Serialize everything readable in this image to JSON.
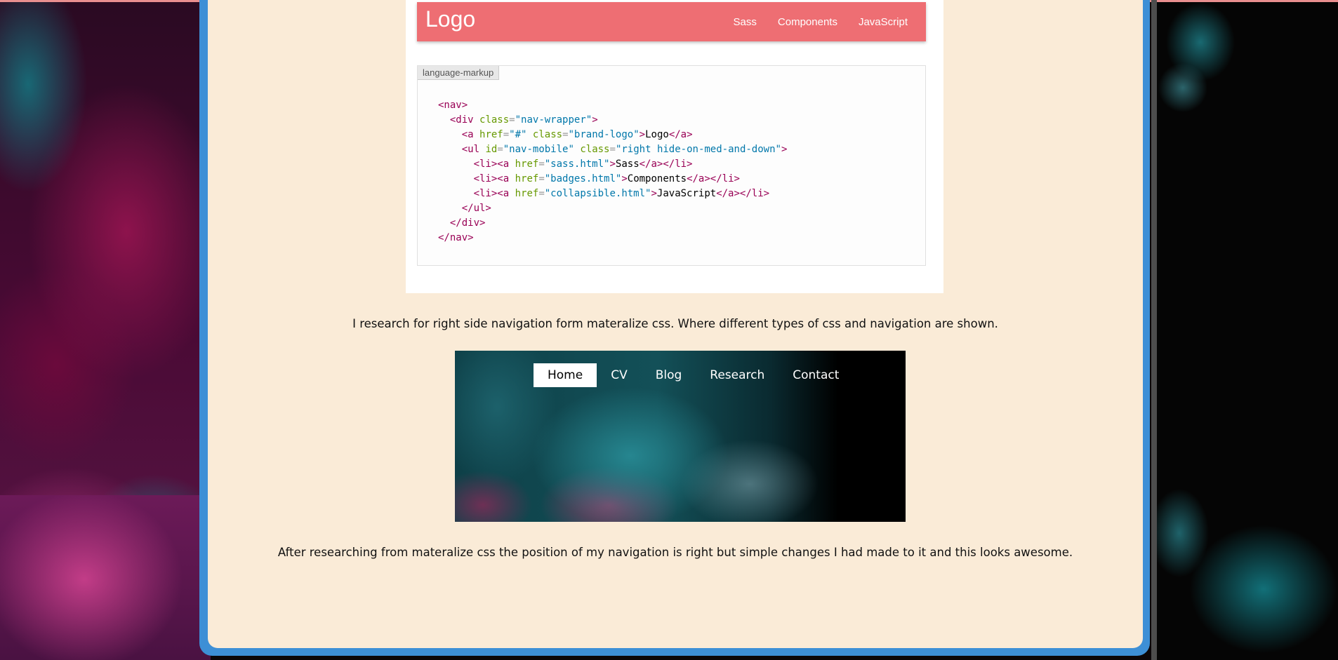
{
  "materialize_nav": {
    "logo": "Logo",
    "links": [
      "Sass",
      "Components",
      "JavaScript"
    ]
  },
  "code_block": {
    "language_label": "language-markup"
  },
  "text": {
    "research_note": "I research for right side navigation form materalize css. Where different types of css and navigation are shown.",
    "conclusion": "After researching from materalize css the position of my navigation is right but simple changes I had made to it and this looks awesome."
  },
  "site_nav": {
    "items": [
      "Home",
      "CV",
      "Blog",
      "Research",
      "Contact"
    ],
    "active": "Home"
  },
  "colors": {
    "panel_bg": "#faebd7",
    "frame_border": "#3d8fd6",
    "materialize_nav_bg": "#ee6e73",
    "code_tag": "#990055",
    "code_attr": "#669900",
    "code_value": "#0077aa"
  }
}
